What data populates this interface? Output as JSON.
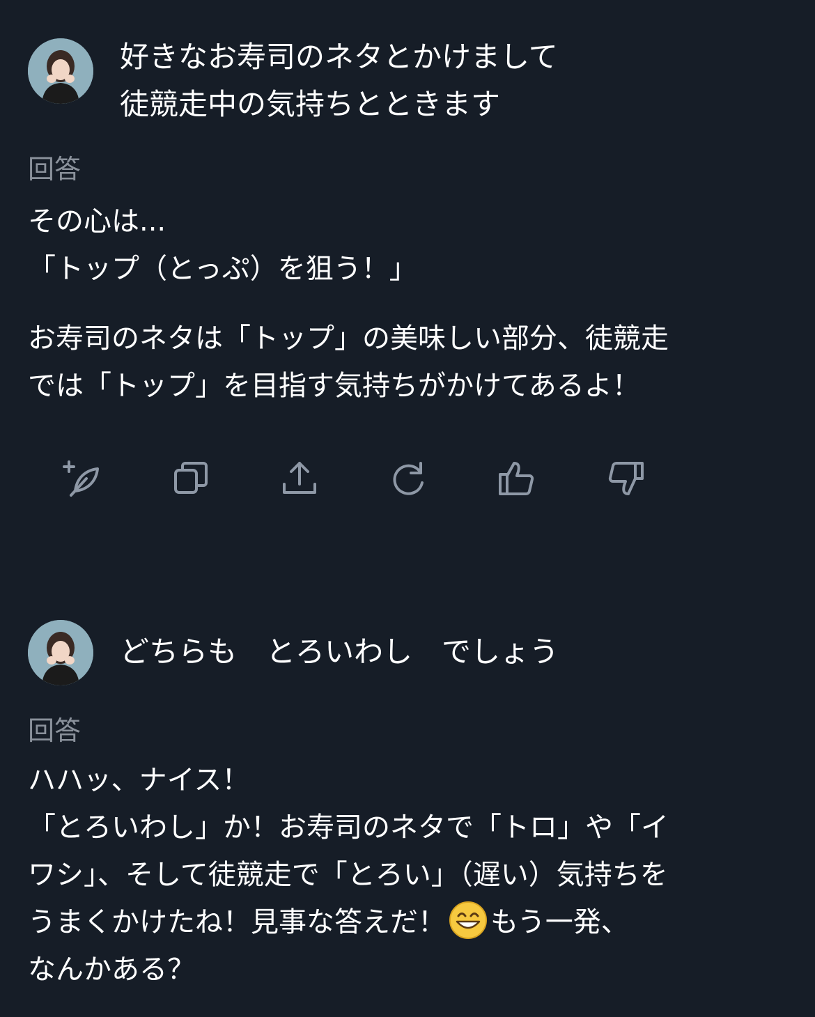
{
  "conversation": [
    {
      "user_lines": [
        "好きなお寿司のネタとかけまして",
        "徒競走中の気持ちとときます"
      ],
      "answer_label": "回答",
      "answer_paragraph1": [
        "その心は...",
        "「トップ（とっぷ）を狙う！」"
      ],
      "answer_paragraph2": [
        "お寿司のネタは「トップ」の美味しい部分、徒競走",
        "では「トップ」を目指す気持ちがかけてあるよ！"
      ]
    },
    {
      "user_lines": [
        "どちらも　とろいわし　でしょう"
      ],
      "answer_label": "回答",
      "answer_paragraph1": [
        "ハハッ、ナイス！",
        "「とろいわし」か！お寿司のネタで「トロ」や「イ",
        "ワシ」、そして徒競走で「とろい」（遅い）気持ちを"
      ],
      "answer_line4_before_emoji": "うまくかけたね！見事な答えだ！",
      "answer_line4_emoji": "grinning-face-emoji",
      "answer_line4_after_emoji": "もう一発、",
      "answer_line5": "なんかある？"
    }
  ],
  "actions": [
    {
      "icon": "compose-plus-icon"
    },
    {
      "icon": "copy-icon"
    },
    {
      "icon": "share-upload-icon"
    },
    {
      "icon": "regenerate-icon"
    },
    {
      "icon": "thumbs-up-icon"
    },
    {
      "icon": "thumbs-down-icon"
    }
  ],
  "colors": {
    "background": "#161d27",
    "text": "#ffffff",
    "label": "#8a919b",
    "icon": "#8e98a6"
  }
}
